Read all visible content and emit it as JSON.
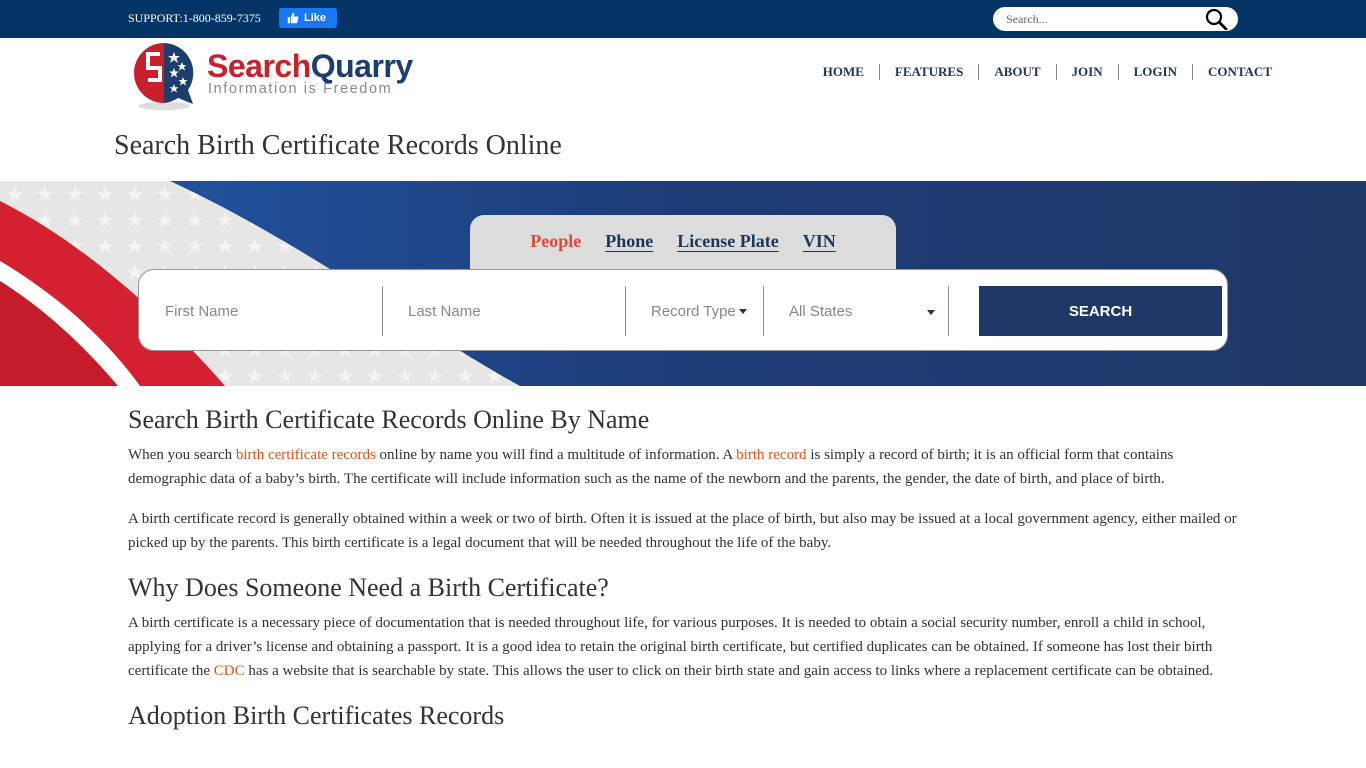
{
  "topbar": {
    "support_text": "SUPPORT:1-800-859-7375",
    "fb_like_label": "Like",
    "search_placeholder": "Search..."
  },
  "logo": {
    "brand_part1": "Search",
    "brand_part2": "Quarry",
    "tagline": "Information is Freedom"
  },
  "nav": {
    "items": [
      {
        "label": "HOME"
      },
      {
        "label": "FEATURES"
      },
      {
        "label": "ABOUT"
      },
      {
        "label": "JOIN"
      },
      {
        "label": "LOGIN"
      },
      {
        "label": "CONTACT"
      }
    ]
  },
  "page_title": "Search Birth Certificate Records Online",
  "search_form": {
    "tabs": [
      {
        "label": "People",
        "active": true
      },
      {
        "label": "Phone",
        "active": false
      },
      {
        "label": "License Plate",
        "active": false
      },
      {
        "label": "VIN",
        "active": false
      }
    ],
    "first_name_placeholder": "First Name",
    "last_name_placeholder": "Last Name",
    "record_type_label": "Record Type",
    "state_selected": "All States",
    "search_button": "SEARCH"
  },
  "colors": {
    "topbar": "#053467",
    "navy": "#1e3867",
    "link_orange": "#e0521b",
    "active_tab": "#e04a3a",
    "brand_red": "#c8202c"
  },
  "article": {
    "sections": [
      {
        "heading": "Search Birth Certificate Records Online By Name",
        "paragraphs": [
          {
            "t1": "When you search ",
            "link1": "birth certificate records",
            "t2": " online by name you will find a multitude of information. A ",
            "link2": "birth record",
            "t3": " is simply a record of birth; it is an official form that contains demographic data of a baby’s birth. The certificate will include information such as the name of the newborn and the parents, the gender, the date of birth, and place of birth."
          },
          {
            "text": "A birth certificate record is generally obtained within a week or two of birth. Often it is issued at the place of birth, but also may be issued at a local government agency, either mailed or picked up by the parents. This birth certificate is a legal document that will be needed throughout the life of the baby."
          }
        ]
      },
      {
        "heading": "Why Does Someone Need a Birth Certificate?",
        "paragraphs": [
          {
            "t1": "A birth certificate is a necessary piece of documentation that is needed throughout life, for various purposes. It is needed to obtain a social security number, enroll a child in school, applying for a driver’s license and obtaining a passport. It is a good idea to retain the original birth certificate, but certified duplicates can be obtained. If someone has lost their birth certificate the ",
            "link1": "CDC",
            "t2": " has a website that is searchable by state. This allows the user to click on their birth state and gain access to links where a replacement certificate can be obtained."
          }
        ]
      },
      {
        "heading": "Adoption Birth Certificates Records"
      }
    ]
  }
}
